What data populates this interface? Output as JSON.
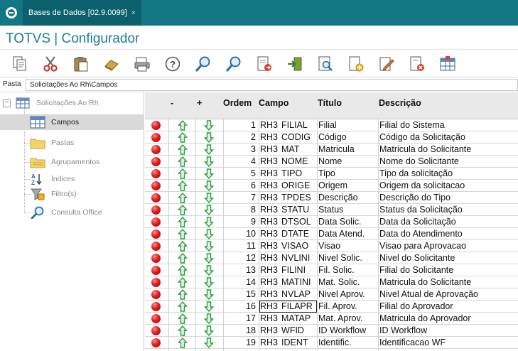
{
  "app": {
    "tab_title": "Bases de Dados [02.9.0099]",
    "tab_close": "×",
    "window_title": "TOTVS | Configurador"
  },
  "toolbar": {
    "buttons": [
      {
        "icon": "copy-icon"
      },
      {
        "icon": "cut-icon"
      },
      {
        "icon": "paste-icon"
      },
      {
        "icon": "eraser-icon"
      },
      {
        "icon": "print-icon"
      },
      {
        "icon": "help-icon"
      },
      {
        "icon": "search-icon"
      },
      {
        "icon": "search-next-icon"
      },
      {
        "icon": "export-icon"
      },
      {
        "icon": "import-icon"
      },
      {
        "icon": "preview-icon"
      },
      {
        "icon": "add-document-icon"
      },
      {
        "icon": "edit-icon"
      },
      {
        "icon": "delete-document-icon"
      },
      {
        "icon": "table-icon"
      }
    ]
  },
  "path": {
    "label": "Pasta",
    "value": "Solicitações Ao Rh\\Campos"
  },
  "tree": {
    "root": "Solicitações Ao Rh",
    "items": [
      {
        "label": "Campos",
        "icon": "table-icon",
        "selected": true
      },
      {
        "label": "Pastas",
        "icon": "folder-icon",
        "selected": false
      },
      {
        "label": "Agrupamentos",
        "icon": "folder-group-icon",
        "selected": false
      },
      {
        "label": "Índices",
        "icon": "sort-az-icon",
        "selected": false
      },
      {
        "label": "Filtro(s)",
        "icon": "filter-icon",
        "selected": false
      },
      {
        "label": "Consulta Office",
        "icon": "magnifier-icon",
        "selected": false
      }
    ]
  },
  "grid": {
    "headers": {
      "minus": "-",
      "plus": "+",
      "ordem": "Ordem",
      "campo": "Campo",
      "titulo": "Título",
      "descricao": "Descrição"
    },
    "rows": [
      {
        "ordem": "1",
        "alias": "RH3",
        "campo": "FILIAL",
        "titulo": "Filial",
        "descricao": "Filial do Sistema"
      },
      {
        "ordem": "2",
        "alias": "RH3",
        "campo": "CODIG",
        "titulo": "Código",
        "descricao": "Código da Solicitação"
      },
      {
        "ordem": "3",
        "alias": "RH3",
        "campo": "MAT",
        "titulo": "Matricula",
        "descricao": "Matricula do Solicitante"
      },
      {
        "ordem": "4",
        "alias": "RH3",
        "campo": "NOME",
        "titulo": "Nome",
        "descricao": "Nome do Solicitante"
      },
      {
        "ordem": "5",
        "alias": "RH3",
        "campo": "TIPO",
        "titulo": "Tipo",
        "descricao": "Tipo da solicitação"
      },
      {
        "ordem": "6",
        "alias": "RH3",
        "campo": "ORIGE",
        "titulo": "Origem",
        "descricao": "Origem da solicitacao"
      },
      {
        "ordem": "7",
        "alias": "RH3",
        "campo": "TPDES",
        "titulo": "Descrição",
        "descricao": "Descrição do Tipo"
      },
      {
        "ordem": "8",
        "alias": "RH3",
        "campo": "STATU",
        "titulo": "Status",
        "descricao": "Status da Solicitação"
      },
      {
        "ordem": "9",
        "alias": "RH3",
        "campo": "DTSOL",
        "titulo": "Data Solic.",
        "descricao": "Data da Solicitação"
      },
      {
        "ordem": "10",
        "alias": "RH3",
        "campo": "DTATE",
        "titulo": "Data Atend.",
        "descricao": "Data do Atendimento"
      },
      {
        "ordem": "11",
        "alias": "RH3",
        "campo": "VISAO",
        "titulo": "Visao",
        "descricao": "Visao para Aprovacao"
      },
      {
        "ordem": "12",
        "alias": "RH3",
        "campo": "NVLINI",
        "titulo": "Nivel Solic.",
        "descricao": "Nivel do Solicitante"
      },
      {
        "ordem": "13",
        "alias": "RH3",
        "campo": "FILINI",
        "titulo": "Fil. Solic.",
        "descricao": "Filial do Solicitante"
      },
      {
        "ordem": "14",
        "alias": "RH3",
        "campo": "MATINI",
        "titulo": "Mat. Solic.",
        "descricao": "Matricula do Solicitante"
      },
      {
        "ordem": "15",
        "alias": "RH3",
        "campo": "NVLAP",
        "titulo": "Nivel Aprov.",
        "descricao": "Nivel Atual de Aprovação"
      },
      {
        "ordem": "16",
        "alias": "RH3",
        "campo": "FILAPR",
        "titulo": "Fil. Aprov.",
        "descricao": "Filial do Aprovador"
      },
      {
        "ordem": "17",
        "alias": "RH3",
        "campo": "MATAP",
        "titulo": "Mat. Aprov.",
        "descricao": "Matricula do Aprovador"
      },
      {
        "ordem": "18",
        "alias": "RH3",
        "campo": "WFID",
        "titulo": "ID Workflow",
        "descricao": "ID Workflow"
      },
      {
        "ordem": "19",
        "alias": "RH3",
        "campo": "IDENT",
        "titulo": "Identific.",
        "descricao": "Identificacao WF"
      }
    ],
    "focused_row": 15
  },
  "colors": {
    "topbar": "#137685",
    "title_text": "#1a7e92",
    "arrow_green": "#2e9b3e",
    "status_red": "#e21d1d"
  }
}
